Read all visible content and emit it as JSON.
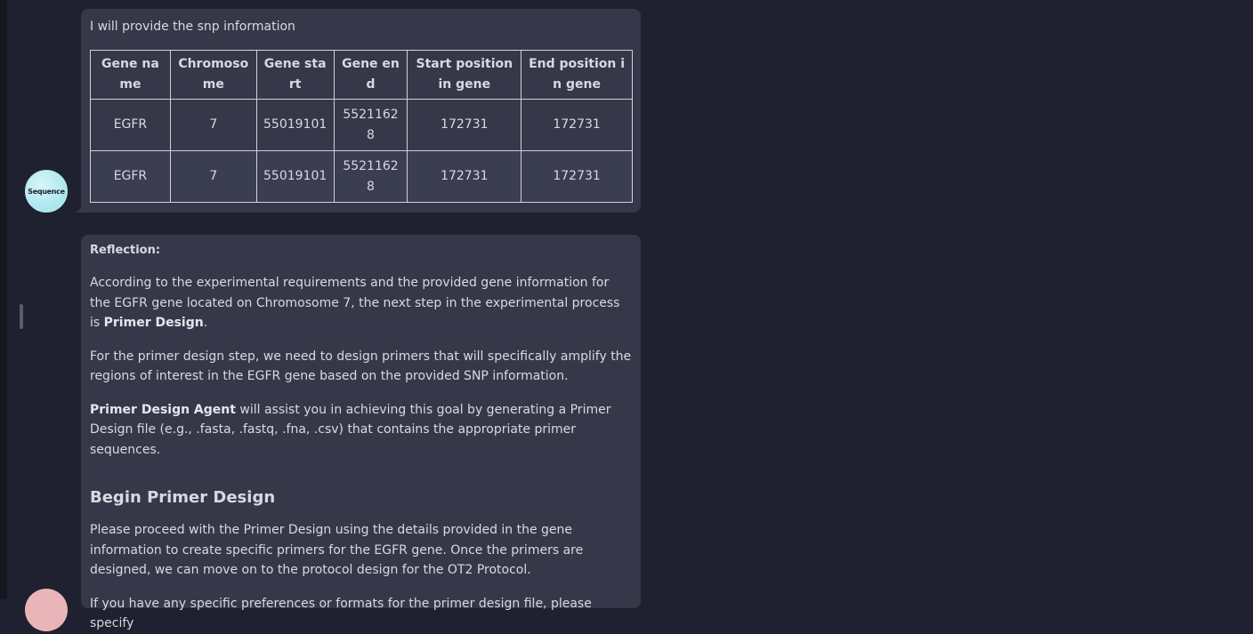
{
  "message_1": {
    "intro": "I will provide the snp information",
    "table": {
      "headers": [
        "Gene name",
        "Chromosome",
        "Gene start",
        "Gene end",
        "Start position in gene",
        "End position in gene"
      ],
      "rows": [
        [
          "EGFR",
          "7",
          "55019101",
          "55211628",
          "172731",
          "172731"
        ],
        [
          "EGFR",
          "7",
          "55019101",
          "55211628",
          "172731",
          "172731"
        ]
      ]
    }
  },
  "sender_avatar": {
    "label": "Sequence"
  },
  "message_2": {
    "reflection_label": "Reflection:",
    "p1_text": "According to the experimental requirements and the provided gene information for the EGFR gene located on Chromosome 7, the next step in the experimental process is ",
    "p1_bold": "Primer Design",
    "p1_end": ".",
    "p2": "For the primer design step, we need to design primers that will specifically amplify the regions of interest in the EGFR gene based on the provided SNP information.",
    "p3_bold": "Primer Design Agent",
    "p3_text": " will assist you in achieving this goal by generating a Primer Design file (e.g., .fasta, .fastq, .fna, .csv) that contains the appropriate primer sequences.",
    "heading": "Begin Primer Design",
    "p4": "Please proceed with the Primer Design using the details provided in the gene information to create specific primers for the EGFR gene. Once the primers are designed, we can move on to the protocol design for the OT2 Protocol.",
    "p5": "If you have any specific preferences or formats for the primer design file, please specify"
  }
}
